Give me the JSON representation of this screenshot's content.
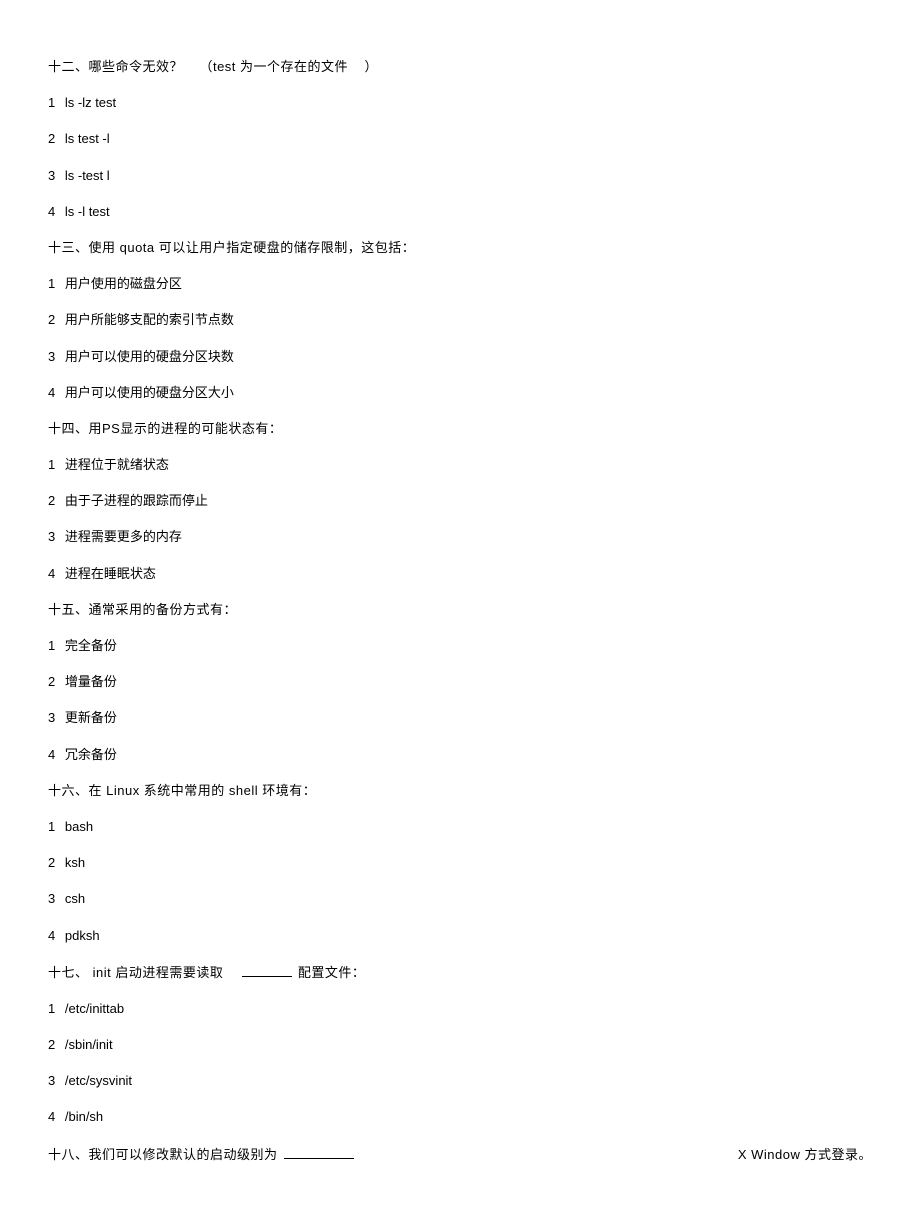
{
  "questions": [
    {
      "title_parts": [
        "十二、哪些命令无效？",
        "（test 为一个存在的文件",
        "）"
      ],
      "options": [
        "ls -lz test",
        "ls test -l",
        "ls -test l",
        "ls -l test"
      ]
    },
    {
      "title": "十三、使用  quota 可以让用户指定硬盘的储存限制，这包括：",
      "options": [
        "用户使用的磁盘分区",
        "用户所能够支配的索引节点数",
        "用户可以使用的硬盘分区块数",
        "用户可以使用的硬盘分区大小"
      ]
    },
    {
      "title": "十四、用PS显示的进程的可能状态有：",
      "options": [
        "进程位于就绪状态",
        "由于子进程的跟踪而停止",
        "进程需要更多的内存",
        "进程在睡眠状态"
      ]
    },
    {
      "title": "十五、通常采用的备份方式有：",
      "options": [
        "完全备份",
        "增量备份",
        "更新备份",
        "冗余备份"
      ]
    },
    {
      "title": "十六、在  Linux 系统中常用的  shell 环境有：",
      "options": [
        "bash",
        "ksh",
        "csh",
        "pdksh"
      ]
    },
    {
      "title_before": "十七、  init 启动进程需要读取",
      "title_after": "配置文件：",
      "options": [
        "/etc/inittab",
        "/sbin/init",
        "/etc/sysvinit",
        "/bin/sh"
      ]
    }
  ],
  "q18": {
    "before": "十八、我们可以修改默认的启动级别为",
    "after": "X Window 方式登录。"
  }
}
